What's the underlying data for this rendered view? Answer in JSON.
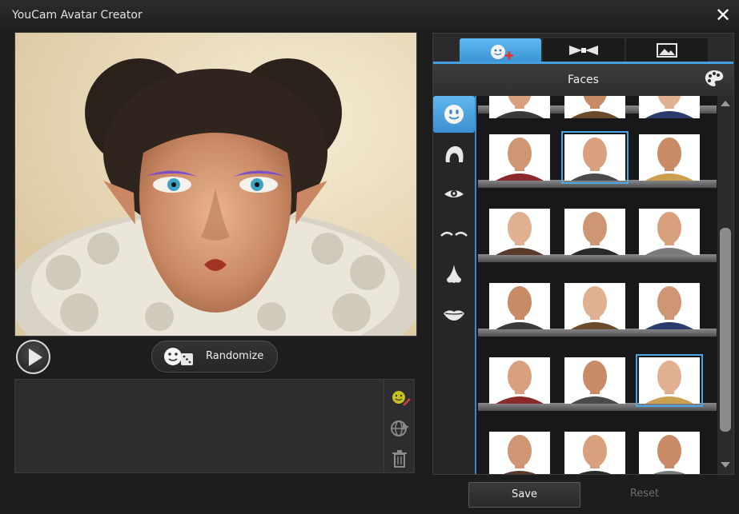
{
  "window": {
    "title": "YouCam Avatar Creator",
    "close_glyph": "✕"
  },
  "controls": {
    "randomize_label": "Randomize"
  },
  "panel": {
    "tabs": [
      {
        "icon": "avatar-face-add-icon",
        "active": true
      },
      {
        "icon": "bow-tie-icon",
        "active": false
      },
      {
        "icon": "landscape-picture-icon",
        "active": false
      }
    ],
    "section_title": "Faces",
    "categories": [
      {
        "icon": "face-smiley-icon",
        "active": true
      },
      {
        "icon": "hair-icon",
        "active": false
      },
      {
        "icon": "eye-icon",
        "active": false
      },
      {
        "icon": "eyebrows-icon",
        "active": false
      },
      {
        "icon": "nose-icon",
        "active": false
      },
      {
        "icon": "lips-icon",
        "active": false
      }
    ]
  },
  "footer": {
    "save_label": "Save",
    "reset_label": "Reset"
  },
  "colors": {
    "accent": "#45a0e0",
    "background": "#1d1d1e"
  }
}
